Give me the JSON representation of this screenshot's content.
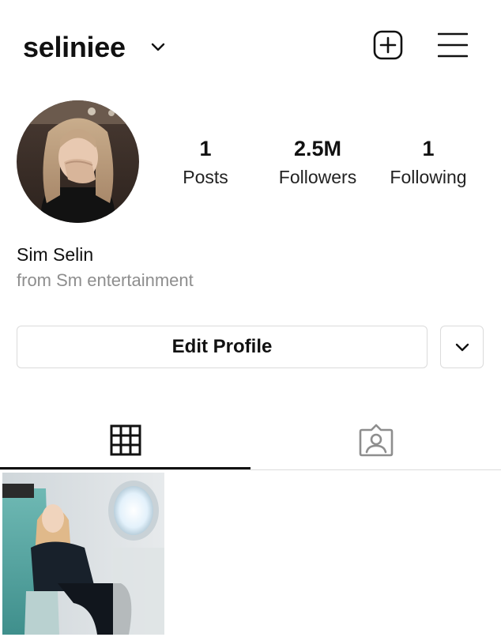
{
  "header": {
    "username": "seliniee",
    "icons": [
      "chevron-down-icon",
      "add-post-icon",
      "menu-icon"
    ]
  },
  "profile": {
    "stats": [
      {
        "value": "1",
        "label": "Posts"
      },
      {
        "value": "2.5M",
        "label": "Followers"
      },
      {
        "value": "1",
        "label": "Following"
      }
    ],
    "full_name": "Sim Selin",
    "bio": "from Sm entertainment"
  },
  "actions": {
    "edit_profile_label": "Edit Profile",
    "more_icon": "chevron-down-icon"
  },
  "tabs": [
    {
      "name": "grid",
      "icon": "grid-icon",
      "active": true
    },
    {
      "name": "tagged",
      "icon": "tagged-icon",
      "active": false
    }
  ],
  "posts": [
    {
      "description_icon": "photo-thumbnail"
    }
  ],
  "colors": {
    "text": "#111111",
    "muted": "#8e8e8e",
    "border": "#dbdbdb",
    "tab_active": "#111111",
    "tab_inactive": "#8e8e8e"
  }
}
